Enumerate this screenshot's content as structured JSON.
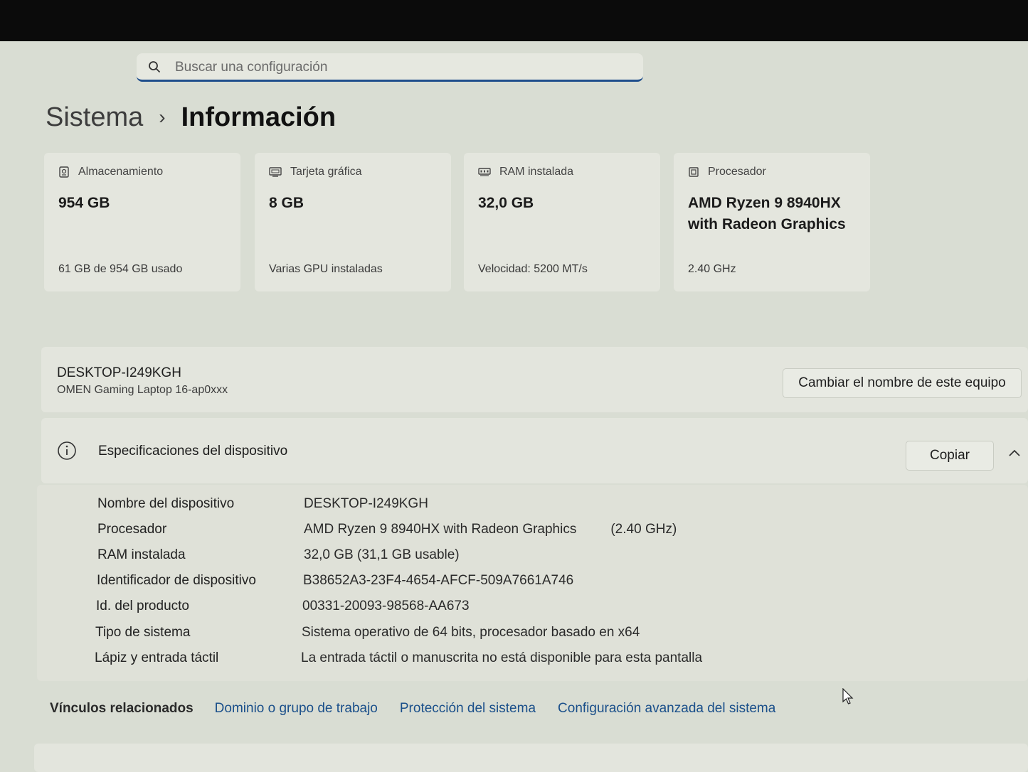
{
  "search": {
    "placeholder": "Buscar una configuración"
  },
  "breadcrumb": {
    "parent": "Sistema",
    "separator": "›",
    "current": "Información"
  },
  "cards": [
    {
      "icon": "storage-icon",
      "title": "Almacenamiento",
      "value": "954 GB",
      "sub": "61 GB de 954 GB usado"
    },
    {
      "icon": "gpu-icon",
      "title": "Tarjeta gráfica",
      "value": "8 GB",
      "sub": "Varias GPU instaladas"
    },
    {
      "icon": "ram-icon",
      "title": "RAM instalada",
      "value": "32,0 GB",
      "sub": "Velocidad: 5200 MT/s"
    },
    {
      "icon": "processor-icon",
      "title": "Procesador",
      "value": "AMD Ryzen 9 8940HX with Radeon Graphics",
      "sub": "2.40 GHz"
    }
  ],
  "device": {
    "name": "DESKTOP-I249KGH",
    "model": "OMEN Gaming Laptop 16-ap0xxx",
    "rename_label": "Cambiar el nombre de este equipo"
  },
  "specs": {
    "title": "Especificaciones del dispositivo",
    "copy_label": "Copiar",
    "rows": [
      {
        "key": "Nombre del dispositivo",
        "value": "DESKTOP-I249KGH",
        "extra": ""
      },
      {
        "key": "Procesador",
        "value": "AMD Ryzen 9 8940HX with Radeon Graphics",
        "extra": "(2.40 GHz)"
      },
      {
        "key": "RAM instalada",
        "value": "32,0 GB (31,1 GB usable)",
        "extra": ""
      },
      {
        "key": "Identificador de dispositivo",
        "value": "B38652A3-23F4-4654-AFCF-509A7661A746",
        "extra": ""
      },
      {
        "key": "Id. del producto",
        "value": "00331-20093-98568-AA673",
        "extra": ""
      },
      {
        "key": "Tipo de sistema",
        "value": "Sistema operativo de 64 bits, procesador basado en x64",
        "extra": ""
      },
      {
        "key": "Lápiz y entrada táctil",
        "value": "La entrada táctil o manuscrita no está disponible para esta pantalla",
        "extra": ""
      }
    ]
  },
  "related": {
    "label": "Vínculos relacionados",
    "links": [
      "Dominio o grupo de trabajo",
      "Protección del sistema",
      "Configuración avanzada del sistema"
    ]
  },
  "colors": {
    "accent": "#1f4e8c",
    "link": "#1a4f8a"
  }
}
